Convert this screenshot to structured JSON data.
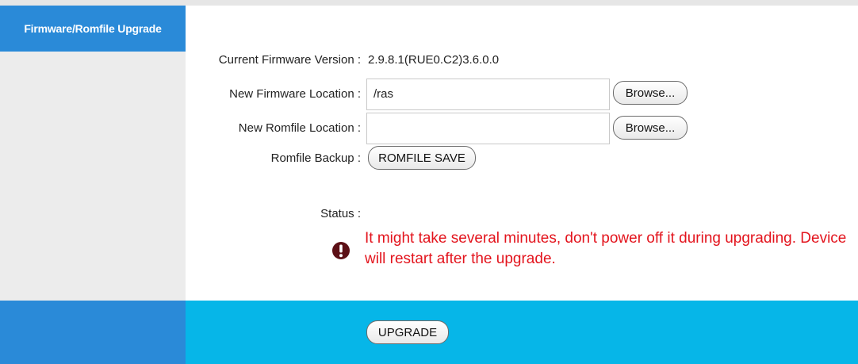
{
  "sidebar": {
    "title": "Firmware/Romfile Upgrade"
  },
  "form": {
    "current_firmware_label": "Current Firmware Version :",
    "current_firmware_value": "2.9.8.1(RUE0.C2)3.6.0.0",
    "new_firmware_label": "New Firmware Location :",
    "new_firmware_value": "/ras",
    "new_romfile_label": "New Romfile Location :",
    "new_romfile_value": "",
    "browse_label": "Browse...",
    "romfile_backup_label": "Romfile Backup :",
    "romfile_save_label": "ROMFILE SAVE",
    "status_label": "Status :",
    "status_message": "It might take several minutes, don't power off it during upgrading. Device will restart after the upgrade."
  },
  "footer": {
    "upgrade_label": "UPGRADE"
  },
  "colors": {
    "header_blue": "#2a8ad8",
    "footer_cyan": "#06b6e8",
    "warning_red": "#e3141d"
  },
  "icons": {
    "status": "exclamation-icon"
  }
}
